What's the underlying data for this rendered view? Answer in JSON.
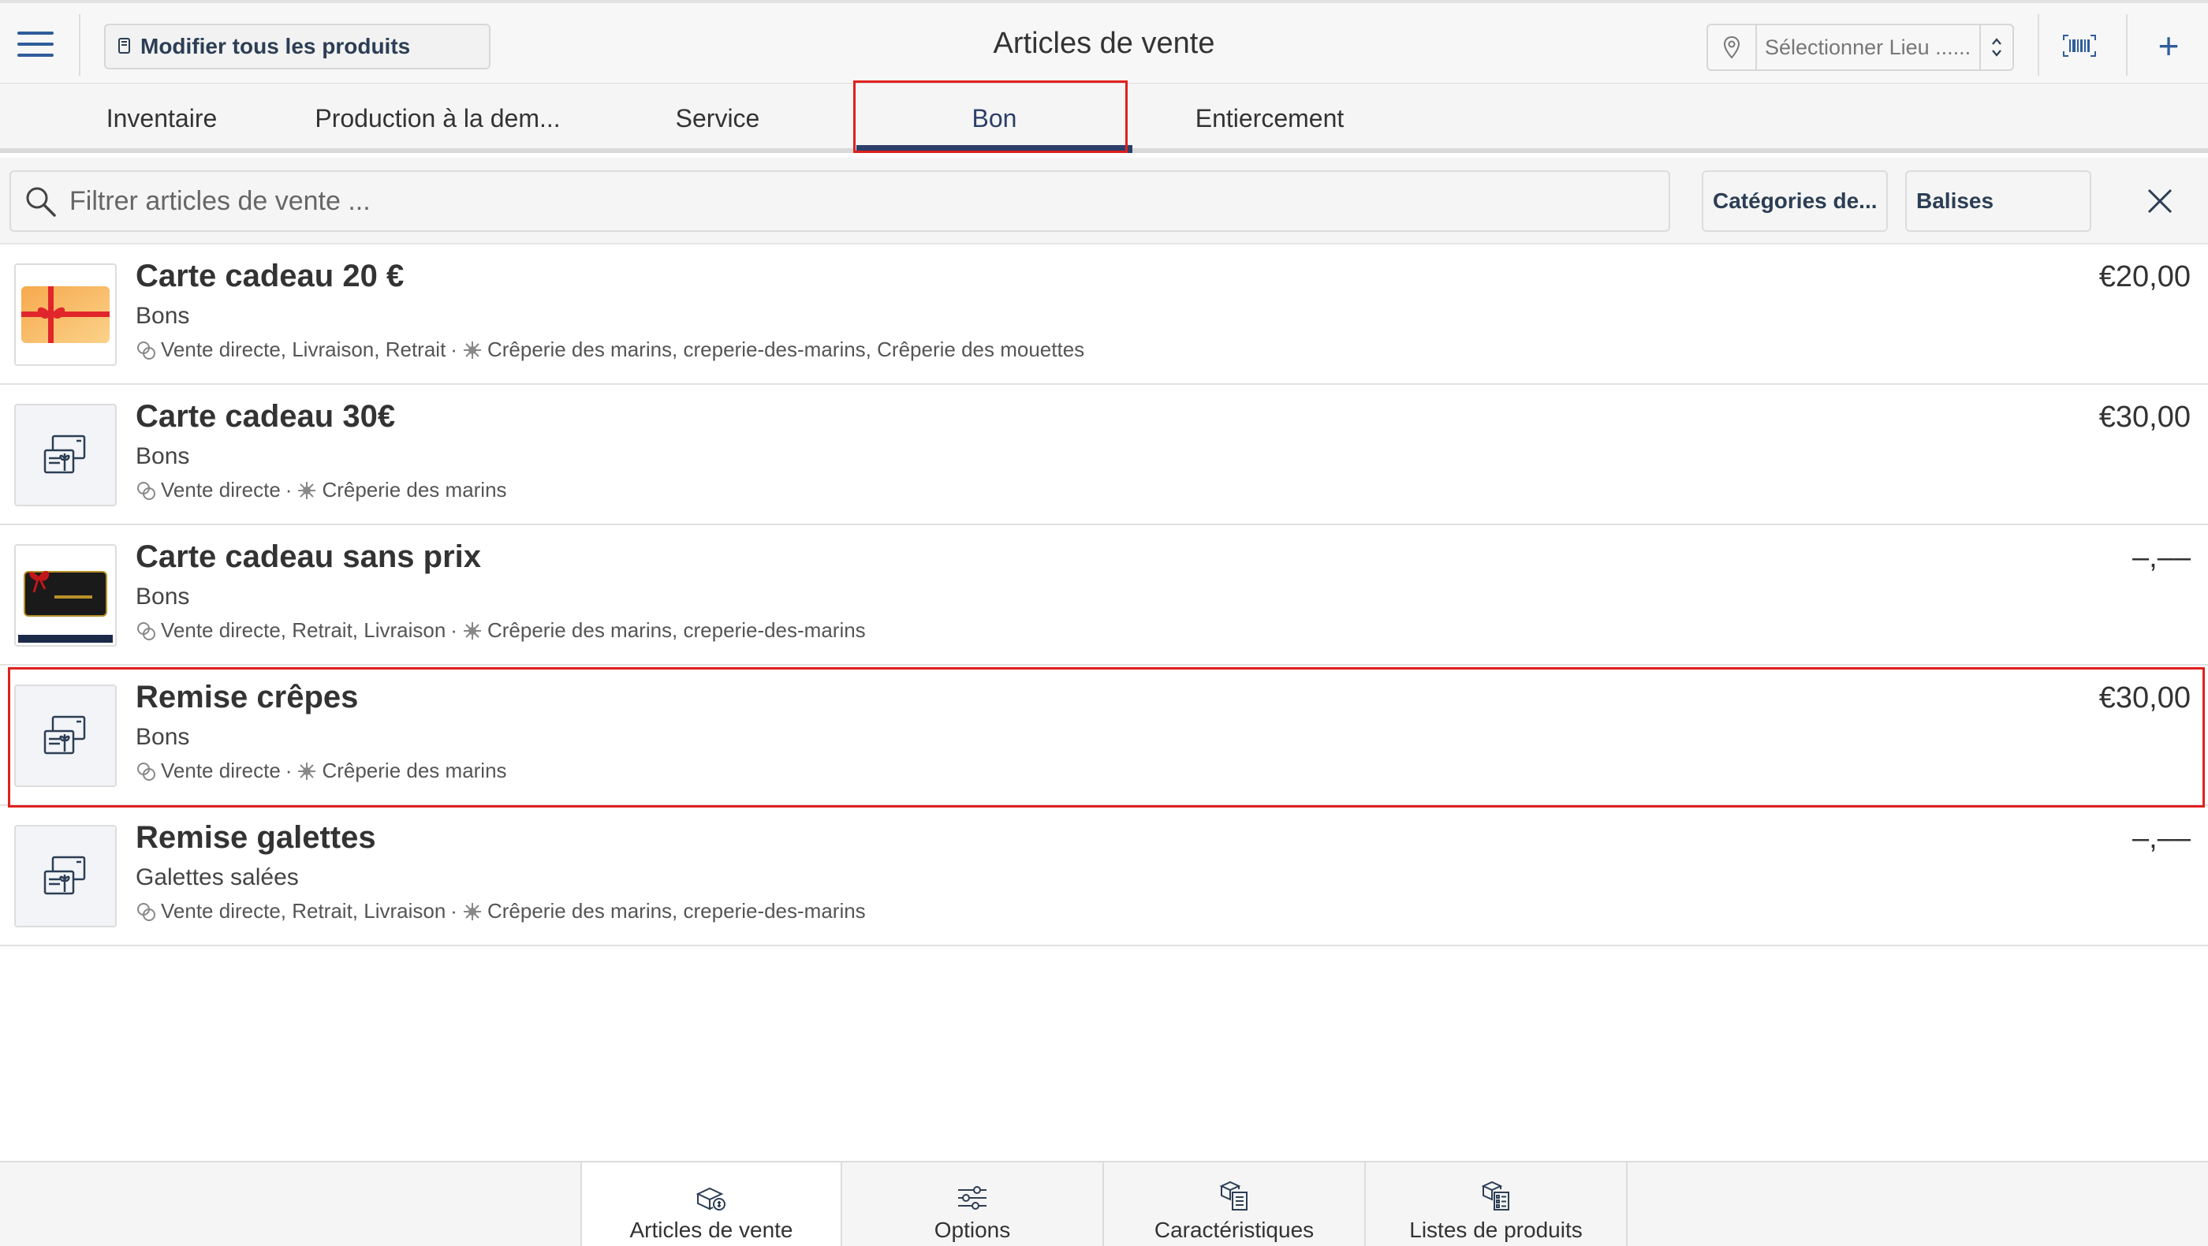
{
  "header": {
    "edit_all_label": "Modifier tous les produits",
    "title": "Articles de vente",
    "location_placeholder": "Sélectionner Lieu ......",
    "icons": [
      "menu-icon",
      "edit-icon",
      "location-pin-icon",
      "spinner-icon",
      "barcode-icon",
      "plus-icon"
    ]
  },
  "tabs": [
    {
      "label": "Inventaire",
      "active": false
    },
    {
      "label": "Production à la dem...",
      "active": false
    },
    {
      "label": "Service",
      "active": false
    },
    {
      "label": "Bon",
      "active": true
    },
    {
      "label": "Entiercement",
      "active": false
    }
  ],
  "filter": {
    "search_placeholder": "Filtrer articles de vente ...",
    "categories_label": "Catégories de...",
    "tags_label": "Balises"
  },
  "items": [
    {
      "name": "Carte cadeau 20 €",
      "category": "Bons",
      "channels": "Vente directe, Livraison, Retrait",
      "locations": "Crêperie des marins, creperie-des-marins, Crêperie des mouettes",
      "price": "€20,00",
      "thumb": "gift-card-image"
    },
    {
      "name": "Carte cadeau 30€",
      "category": "Bons",
      "channels": "Vente directe",
      "locations": "Crêperie des marins",
      "price": "€30,00",
      "thumb": "voucher-icon"
    },
    {
      "name": "Carte cadeau sans prix",
      "category": "Bons",
      "channels": "Vente directe, Retrait, Livraison",
      "locations": "Crêperie des marins, creperie-des-marins",
      "price": "–,––",
      "thumb": "gift-card-black-image"
    },
    {
      "name": "Remise crêpes",
      "category": "Bons",
      "channels": "Vente directe",
      "locations": "Crêperie des marins",
      "price": "€30,00",
      "thumb": "voucher-icon"
    },
    {
      "name": "Remise galettes",
      "category": "Galettes salées",
      "channels": "Vente directe, Retrait, Livraison",
      "locations": "Crêperie des marins, creperie-des-marins",
      "price": "–,––",
      "thumb": "voucher-icon"
    }
  ],
  "bottom_nav": [
    {
      "label": "Articles de vente",
      "active": true
    },
    {
      "label": "Options",
      "active": false
    },
    {
      "label": "Caractéristiques",
      "active": false
    },
    {
      "label": "Listes de produits",
      "active": false
    }
  ],
  "colors": {
    "accent": "#2c3e6a",
    "highlight": "#e0201e",
    "icon_blue": "#2f5d9a"
  }
}
